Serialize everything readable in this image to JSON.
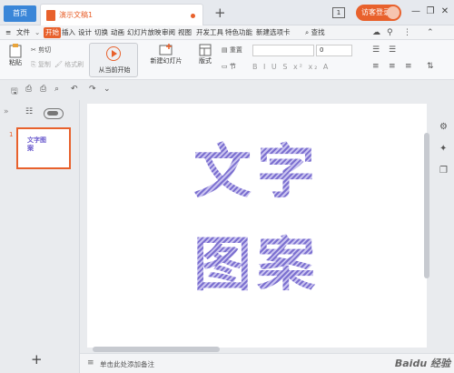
{
  "titlebar": {
    "home_tab": "首页",
    "doc_tab": "演示文稿1",
    "new_tab": "+",
    "badge": "1",
    "login": "访客登录",
    "minimize": "—",
    "maximize": "❐",
    "close": "✕"
  },
  "menu": {
    "hamburger": "≡",
    "file": "文件",
    "items": [
      "开始",
      "插入",
      "设计",
      "切换",
      "动画",
      "幻灯片放映",
      "审阅",
      "视图",
      "开发工具",
      "特色功能",
      "新建选项卡"
    ],
    "active": "开始",
    "search": "查找"
  },
  "ribbon": {
    "paste": "粘贴",
    "cut": "剪切",
    "copy": "复制",
    "format_painter": "格式刷",
    "play_from_current": "从当前开始",
    "new_slide": "新建幻灯片",
    "layout": "版式",
    "reset": "重置",
    "section": "节",
    "font_size": "0"
  },
  "left_panel": {
    "slide_number": "1",
    "thumb_text": "文字图案",
    "add": "+"
  },
  "slide": {
    "line1": "文字",
    "line2": "图案"
  },
  "notes": {
    "placeholder": "单击此处添加备注"
  },
  "watermark": "Baidu 经验",
  "colors": {
    "accent": "#e8612c",
    "home_tab": "#3a86d8",
    "art_fill": "#7b6fd0"
  }
}
